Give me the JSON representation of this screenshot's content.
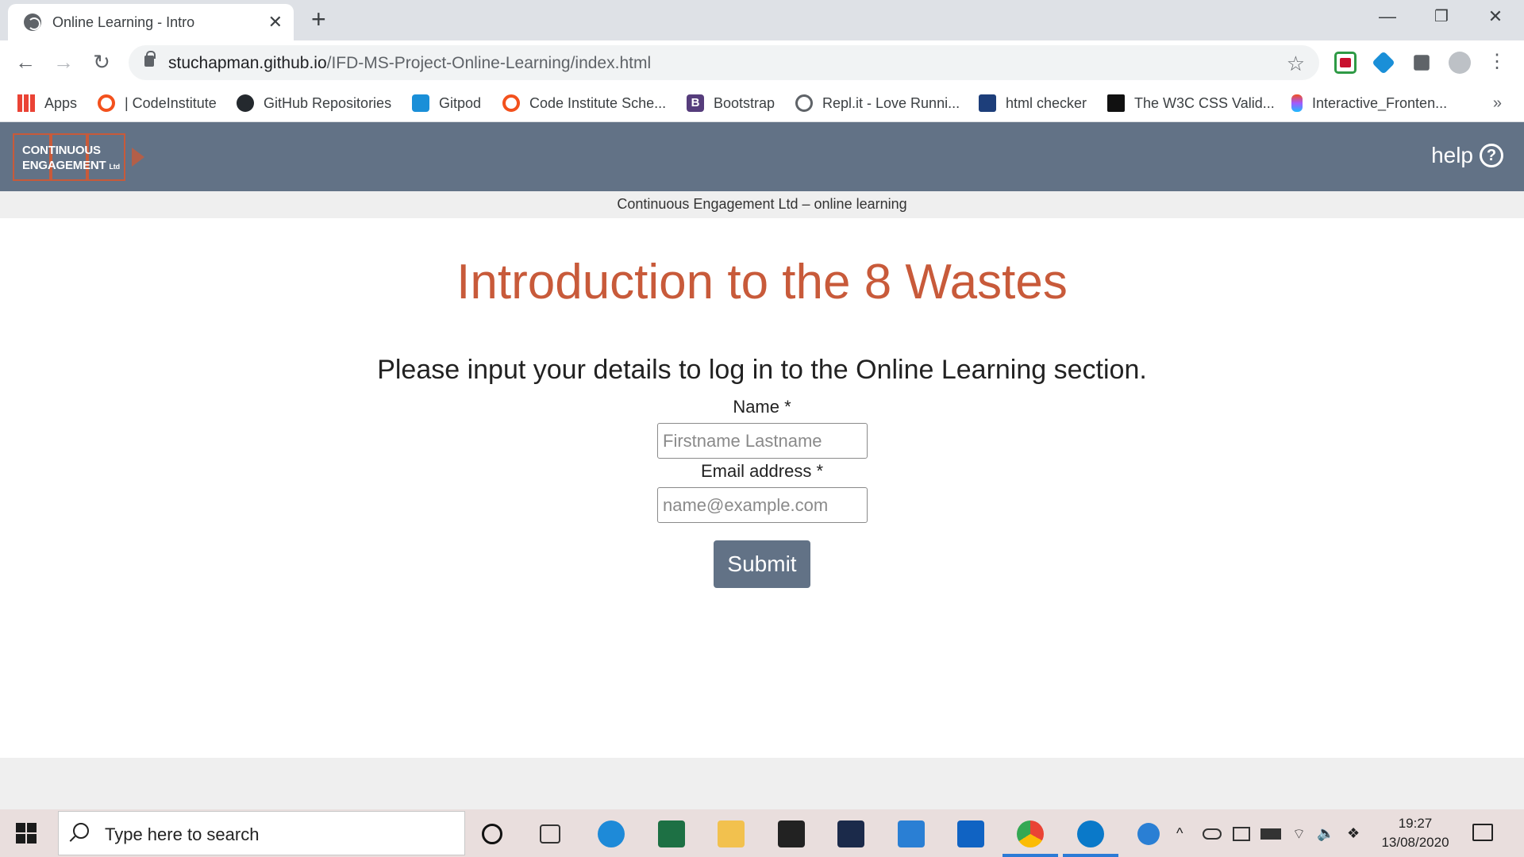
{
  "browser": {
    "tab_title": "Online Learning - Intro",
    "tab_close": "✕",
    "new_tab": "+",
    "window_controls": {
      "minimize": "—",
      "restore": "❐",
      "close": "✕"
    },
    "url_host": "stuchapman.github.io",
    "url_path": "/IFD-MS-Project-Online-Learning/index.html",
    "back": "←",
    "forward": "→",
    "reload": "↻",
    "star": "☆",
    "bookmarks": [
      {
        "label": "Apps",
        "icon": "apps-grid-icon",
        "color": "#4285f4"
      },
      {
        "label": "| CodeInstitute",
        "icon": "codeinstitute-icon",
        "color": "#f3511d"
      },
      {
        "label": "GitHub Repositories",
        "icon": "github-icon",
        "color": "#24292e"
      },
      {
        "label": "Gitpod",
        "icon": "gitpod-icon",
        "color": "#1a8fd8"
      },
      {
        "label": "Code Institute Sche...",
        "icon": "codeinstitute-icon",
        "color": "#f3511d"
      },
      {
        "label": "Bootstrap",
        "icon": "bootstrap-icon",
        "color": "#563d7c"
      },
      {
        "label": "Repl.it - Love Runni...",
        "icon": "replit-icon",
        "color": "#5f6368"
      },
      {
        "label": "html checker",
        "icon": "w3c-html-icon",
        "color": "#1d3e7a"
      },
      {
        "label": "The W3C CSS Valid...",
        "icon": "w3c-css-icon",
        "color": "#111111"
      },
      {
        "label": "Interactive_Fronten...",
        "icon": "figma-icon",
        "color": "#a259ff"
      }
    ],
    "bookmarks_more": "»"
  },
  "site": {
    "logo_line1": "CONTINUOUS",
    "logo_line2": "ENGAGEMENT",
    "logo_suffix": "Ltd",
    "help_label": "help",
    "help_icon": "?",
    "subheader": "Continuous Engagement Ltd – online learning",
    "title": "Introduction to the 8 Wastes",
    "instructions": "Please input your details to log in to the Online Learning section.",
    "name_label": "Name *",
    "name_placeholder": "Firstname Lastname",
    "email_label": "Email address *",
    "email_placeholder": "name@example.com",
    "submit_label": "Submit",
    "colors": {
      "header": "#627286",
      "accent": "#c85a3a"
    }
  },
  "taskbar": {
    "search_placeholder": "Type here to search",
    "time": "19:27",
    "date": "13/08/2020",
    "tray_chevron": "^",
    "tray_volume": "🔈"
  }
}
